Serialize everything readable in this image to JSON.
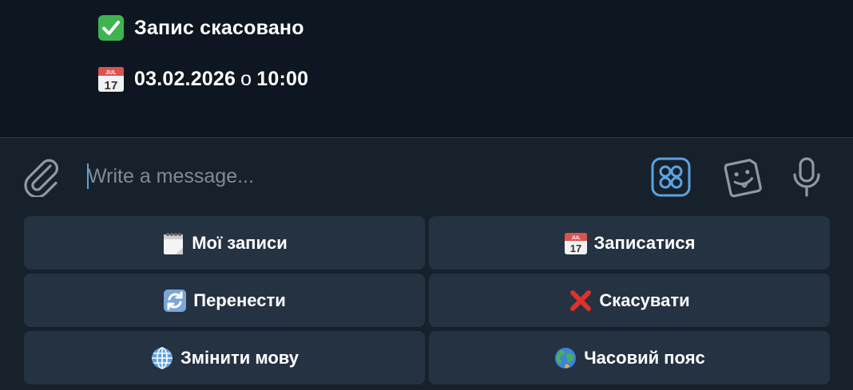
{
  "messages": [
    {
      "icon": "check-mark-button-emoji",
      "text": "Запис скасовано"
    },
    {
      "icon": "calendar-emoji",
      "date": "03.02.2026",
      "connector": "о",
      "time": "10:00",
      "calendar_month": "JUL",
      "calendar_day": "17"
    }
  ],
  "composer": {
    "placeholder": "Write a message...",
    "value": ""
  },
  "keyboard": {
    "rows": [
      [
        {
          "icon": "spiral-notepad-emoji",
          "label": "Мої записи"
        },
        {
          "icon": "calendar-emoji",
          "label": "Записатися",
          "calendar_month": "JUL",
          "calendar_day": "17"
        }
      ],
      [
        {
          "icon": "arrows-counterclockwise-emoji",
          "label": "Перенести"
        },
        {
          "icon": "cross-mark-emoji",
          "label": "Скасувати"
        }
      ],
      [
        {
          "icon": "globe-meridians-emoji",
          "label": "Змінити мову"
        },
        {
          "icon": "earth-globe-emoji",
          "label": "Часовий пояс"
        }
      ]
    ]
  },
  "colors": {
    "chat_background": "#0e1621",
    "panel_background": "#17212b",
    "button_background": "#253242",
    "accent": "#5ba3e0",
    "placeholder": "#7f8b97",
    "icon_gray": "#8e99a4"
  }
}
